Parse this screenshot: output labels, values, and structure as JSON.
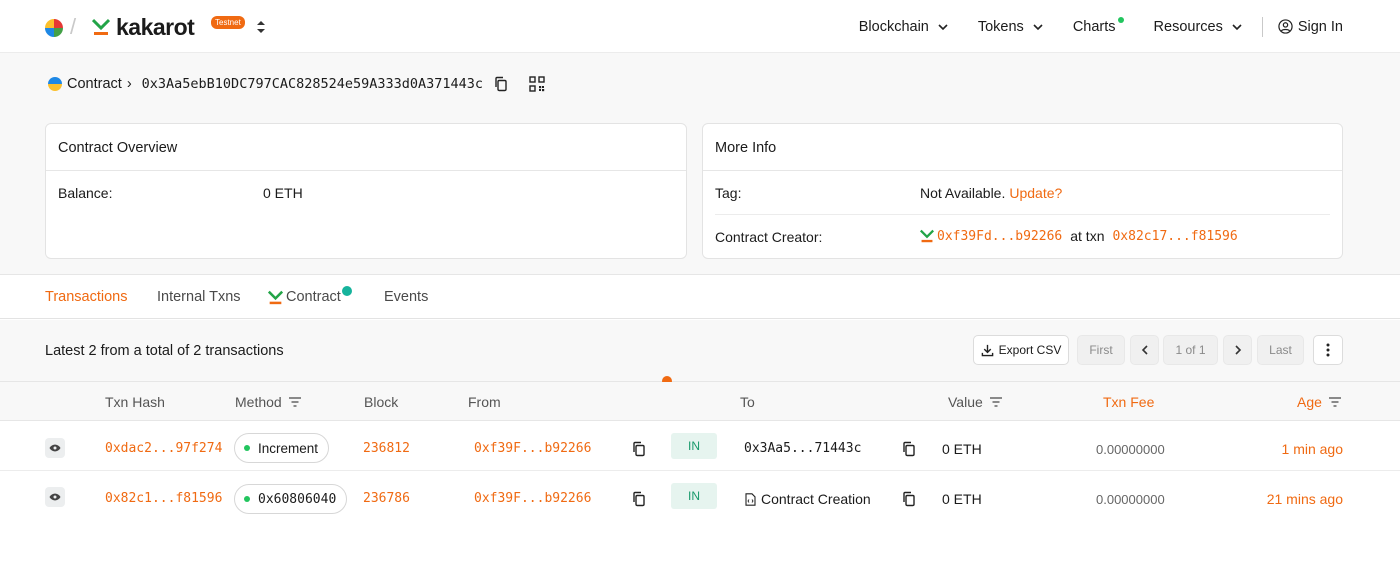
{
  "header": {
    "brand_name": "kakarot",
    "network_badge": "Testnet",
    "nav": [
      {
        "label": "Blockchain",
        "has_menu": true
      },
      {
        "label": "Tokens",
        "has_menu": true
      },
      {
        "label": "Charts",
        "has_menu": false,
        "has_new_dot": true
      },
      {
        "label": "Resources",
        "has_menu": true
      }
    ],
    "sign_in": "Sign In"
  },
  "breadcrumb": {
    "label": "Contract",
    "separator": "›",
    "address": "0x3Aa5ebB10DC797CAC828524e59A333d0A371443c"
  },
  "overview": {
    "title": "Contract Overview",
    "balance_label": "Balance:",
    "balance_value": "0 ETH"
  },
  "more_info": {
    "title": "More Info",
    "tag_label": "Tag:",
    "tag_value": "Not Available.",
    "tag_link": "Update?",
    "creator_label": "Contract Creator:",
    "creator_address": "0xf39Fd...b92266",
    "at_txn": "at txn",
    "creator_txn": "0x82c17...f81596"
  },
  "tabs": [
    {
      "label": "Transactions",
      "active": true
    },
    {
      "label": "Internal Txns",
      "active": false
    },
    {
      "label": "Contract",
      "active": false,
      "verified": true
    },
    {
      "label": "Events",
      "active": false
    }
  ],
  "toolbar": {
    "summary": "Latest 2 from a total of 2 transactions",
    "export": "Export CSV",
    "first": "First",
    "page": "1 of 1",
    "last": "Last"
  },
  "table": {
    "columns": [
      "Txn Hash",
      "Method",
      "Block",
      "From",
      "To",
      "Value",
      "Txn Fee",
      "Age"
    ],
    "rows": [
      {
        "hash": "0xdac2...97f274",
        "method": "Increment",
        "block": "236812",
        "from": "0xf39F...b92266",
        "direction": "IN",
        "to": "0x3Aa5...71443c",
        "to_is_contract_creation": false,
        "value": "0 ETH",
        "fee": "0.00000000",
        "age": "1 min ago"
      },
      {
        "hash": "0x82c1...f81596",
        "method": "0x60806040",
        "block": "236786",
        "from": "0xf39F...b92266",
        "direction": "IN",
        "to": "Contract Creation",
        "to_is_contract_creation": true,
        "value": "0 ETH",
        "fee": "0.00000000",
        "age": "21 mins ago"
      }
    ]
  },
  "colors": {
    "accent": "#f06a12",
    "brand_green": "#22a447",
    "in_badge": "#e6f4ef"
  }
}
